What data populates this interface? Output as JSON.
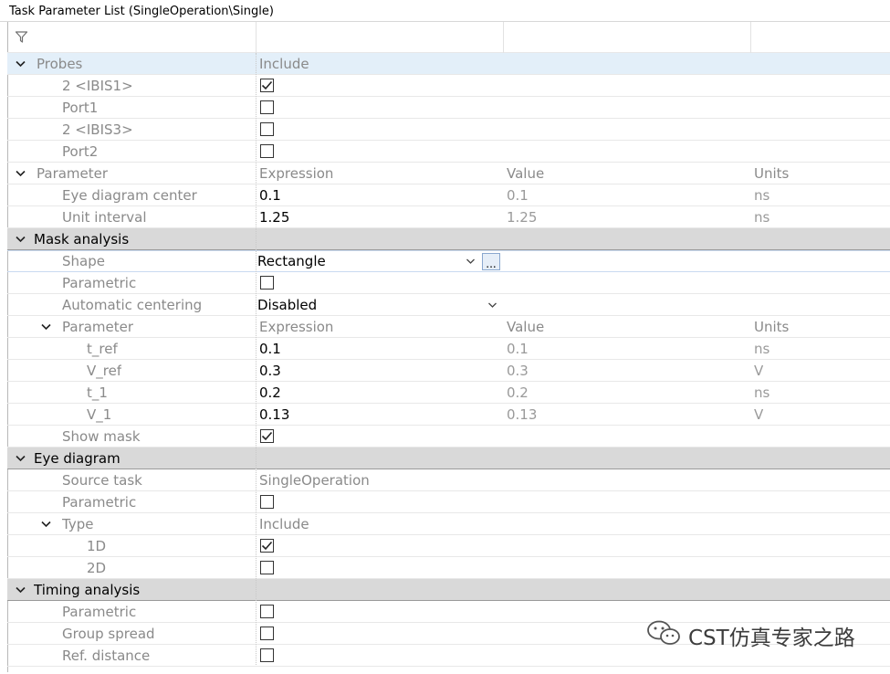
{
  "window": {
    "title": "Task Parameter List (SingleOperation\\Single)"
  },
  "filter": {
    "icon": "filter-icon"
  },
  "rows": [
    {
      "kind": "group",
      "id": "probes",
      "label": "Probes",
      "col2": "Include",
      "level": 0
    },
    {
      "kind": "check",
      "id": "probe-ibis1",
      "label": "2 <IBIS1>",
      "checked": true,
      "level": 1
    },
    {
      "kind": "check",
      "id": "probe-port1",
      "label": "Port1",
      "checked": false,
      "level": 1
    },
    {
      "kind": "check",
      "id": "probe-ibis3",
      "label": "2 <IBIS3>",
      "checked": false,
      "level": 1
    },
    {
      "kind": "check",
      "id": "probe-port2",
      "label": "Port2",
      "checked": false,
      "level": 1
    },
    {
      "kind": "header",
      "id": "parameter-header",
      "label": "Parameter",
      "col2": "Expression",
      "col3": "Value",
      "col4": "Units",
      "level": 0
    },
    {
      "kind": "param",
      "id": "eye-diagram-center",
      "label": "Eye diagram center",
      "expr": "0.1",
      "value": "0.1",
      "units": "ns",
      "level": 1
    },
    {
      "kind": "param",
      "id": "unit-interval",
      "label": "Unit interval",
      "expr": "1.25",
      "value": "1.25",
      "units": "ns",
      "level": 1
    },
    {
      "kind": "section",
      "id": "mask-analysis",
      "label": "Mask analysis"
    },
    {
      "kind": "shape",
      "id": "shape",
      "label": "Shape",
      "value": "Rectangle",
      "button": "...",
      "level": 1
    },
    {
      "kind": "check",
      "id": "mask-parametric",
      "label": "Parametric",
      "checked": false,
      "level": 1
    },
    {
      "kind": "select",
      "id": "automatic-centering",
      "label": "Automatic centering",
      "value": "Disabled",
      "level": 1
    },
    {
      "kind": "header",
      "id": "mask-parameter-header",
      "label": "Parameter",
      "col2": "Expression",
      "col3": "Value",
      "col4": "Units",
      "level": 1
    },
    {
      "kind": "param",
      "id": "t-ref",
      "label": "t_ref",
      "expr": "0.1",
      "value": "0.1",
      "units": "ns",
      "level": 2
    },
    {
      "kind": "param",
      "id": "v-ref",
      "label": "V_ref",
      "expr": "0.3",
      "value": "0.3",
      "units": "V",
      "level": 2
    },
    {
      "kind": "param",
      "id": "t-1",
      "label": "t_1",
      "expr": "0.2",
      "value": "0.2",
      "units": "ns",
      "level": 2
    },
    {
      "kind": "param",
      "id": "v-1",
      "label": "V_1",
      "expr": "0.13",
      "value": "0.13",
      "units": "V",
      "level": 2
    },
    {
      "kind": "check",
      "id": "show-mask",
      "label": "Show mask",
      "checked": true,
      "level": 1
    },
    {
      "kind": "section",
      "id": "eye-diagram",
      "label": "Eye diagram"
    },
    {
      "kind": "text",
      "id": "source-task",
      "label": "Source task",
      "col2": "SingleOperation",
      "level": 1
    },
    {
      "kind": "check",
      "id": "eye-parametric",
      "label": "Parametric",
      "checked": false,
      "level": 1
    },
    {
      "kind": "header",
      "id": "type-header",
      "label": "Type",
      "col2": "Include",
      "level": 1
    },
    {
      "kind": "check",
      "id": "type-1d",
      "label": "1D",
      "checked": true,
      "level": 2
    },
    {
      "kind": "check",
      "id": "type-2d",
      "label": "2D",
      "checked": false,
      "level": 2
    },
    {
      "kind": "section",
      "id": "timing-analysis",
      "label": "Timing analysis"
    },
    {
      "kind": "check",
      "id": "timing-parametric",
      "label": "Parametric",
      "checked": false,
      "level": 1
    },
    {
      "kind": "check",
      "id": "group-spread",
      "label": "Group spread",
      "checked": false,
      "level": 1
    },
    {
      "kind": "check",
      "id": "ref-distance",
      "label": "Ref. distance",
      "checked": false,
      "level": 1
    }
  ],
  "watermark": {
    "text": "CST仿真专家之路",
    "icon": "wechat-icon"
  },
  "colors": {
    "selected_row": "#e3eff9",
    "section_bg": "#d9d9d9",
    "label_gray": "#8a8a8a"
  }
}
